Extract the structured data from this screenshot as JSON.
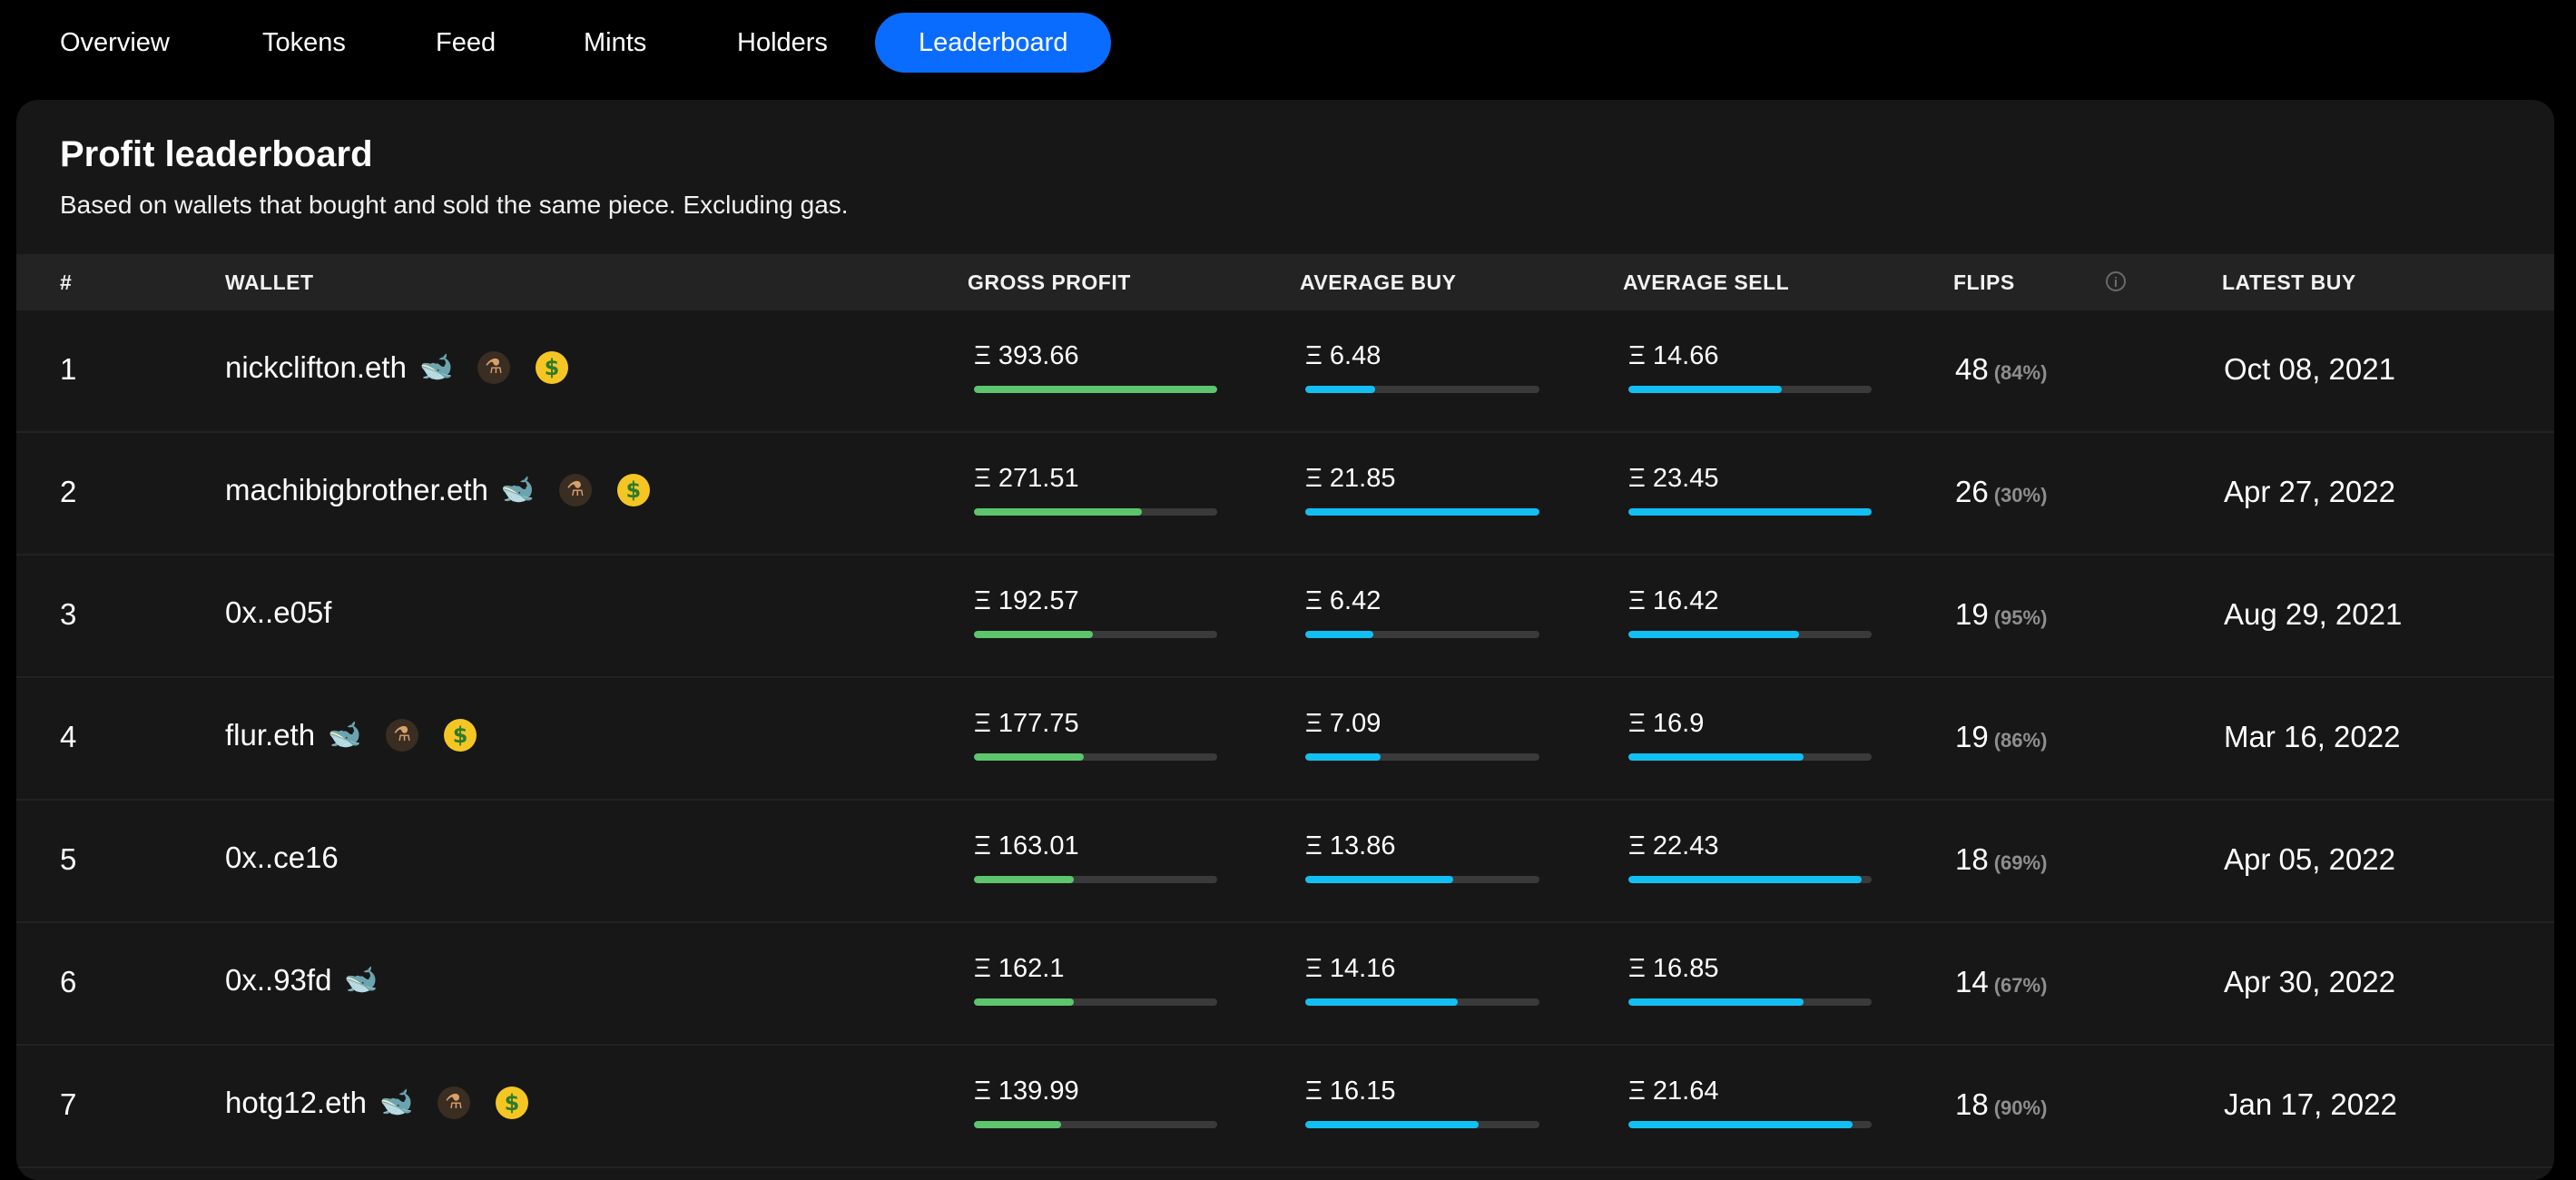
{
  "tabs": [
    {
      "label": "Overview",
      "active": false
    },
    {
      "label": "Tokens",
      "active": false
    },
    {
      "label": "Feed",
      "active": false
    },
    {
      "label": "Mints",
      "active": false
    },
    {
      "label": "Holders",
      "active": false
    },
    {
      "label": "Leaderboard",
      "active": true
    }
  ],
  "leaderboard": {
    "title": "Profit leaderboard",
    "subtitle": "Based on wallets that bought and sold the same piece. Excluding gas.",
    "columns": {
      "rank": "#",
      "wallet": "WALLET",
      "gross_profit": "GROSS PROFIT",
      "average_buy": "AVERAGE BUY",
      "average_sell": "AVERAGE SELL",
      "flips": "FLIPS",
      "latest_buy": "LATEST BUY"
    },
    "colors": {
      "accent": "#0a6cff",
      "profit_bar": "#5cc56e",
      "price_bar": "#12bff2"
    },
    "rows": [
      {
        "rank": "1",
        "wallet": "nickclifton.eth",
        "badges": [
          "whale-icon",
          "scientist-icon",
          "money-face-icon"
        ],
        "gross_profit": "Ξ 393.66",
        "gross_profit_fill": 1.0,
        "average_buy": "Ξ 6.48",
        "average_buy_fill": 0.3,
        "average_sell": "Ξ 14.66",
        "average_sell_fill": 0.63,
        "flips": "48",
        "flips_pct": "(84%)",
        "latest_buy": "Oct 08, 2021"
      },
      {
        "rank": "2",
        "wallet": "machibigbrother.eth",
        "badges": [
          "whale-icon",
          "scientist-icon",
          "money-face-icon"
        ],
        "gross_profit": "Ξ 271.51",
        "gross_profit_fill": 0.69,
        "average_buy": "Ξ 21.85",
        "average_buy_fill": 1.0,
        "average_sell": "Ξ 23.45",
        "average_sell_fill": 1.0,
        "flips": "26",
        "flips_pct": "(30%)",
        "latest_buy": "Apr 27, 2022"
      },
      {
        "rank": "3",
        "wallet": "0x..e05f",
        "badges": [],
        "gross_profit": "Ξ 192.57",
        "gross_profit_fill": 0.49,
        "average_buy": "Ξ 6.42",
        "average_buy_fill": 0.29,
        "average_sell": "Ξ 16.42",
        "average_sell_fill": 0.7,
        "flips": "19",
        "flips_pct": "(95%)",
        "latest_buy": "Aug 29, 2021"
      },
      {
        "rank": "4",
        "wallet": "flur.eth",
        "badges": [
          "whale-icon",
          "scientist-icon",
          "money-face-icon"
        ],
        "gross_profit": "Ξ 177.75",
        "gross_profit_fill": 0.45,
        "average_buy": "Ξ 7.09",
        "average_buy_fill": 0.32,
        "average_sell": "Ξ 16.9",
        "average_sell_fill": 0.72,
        "flips": "19",
        "flips_pct": "(86%)",
        "latest_buy": "Mar 16, 2022"
      },
      {
        "rank": "5",
        "wallet": "0x..ce16",
        "badges": [],
        "gross_profit": "Ξ 163.01",
        "gross_profit_fill": 0.41,
        "average_buy": "Ξ 13.86",
        "average_buy_fill": 0.63,
        "average_sell": "Ξ 22.43",
        "average_sell_fill": 0.96,
        "flips": "18",
        "flips_pct": "(69%)",
        "latest_buy": "Apr 05, 2022"
      },
      {
        "rank": "6",
        "wallet": "0x..93fd",
        "badges": [
          "whale-icon"
        ],
        "gross_profit": "Ξ 162.1",
        "gross_profit_fill": 0.41,
        "average_buy": "Ξ 14.16",
        "average_buy_fill": 0.65,
        "average_sell": "Ξ 16.85",
        "average_sell_fill": 0.72,
        "flips": "14",
        "flips_pct": "(67%)",
        "latest_buy": "Apr 30, 2022"
      },
      {
        "rank": "7",
        "wallet": "hotg12.eth",
        "badges": [
          "whale-icon",
          "scientist-icon",
          "money-face-icon"
        ],
        "gross_profit": "Ξ 139.99",
        "gross_profit_fill": 0.36,
        "average_buy": "Ξ 16.15",
        "average_buy_fill": 0.74,
        "average_sell": "Ξ 21.64",
        "average_sell_fill": 0.92,
        "flips": "18",
        "flips_pct": "(90%)",
        "latest_buy": "Jan 17, 2022"
      }
    ]
  }
}
